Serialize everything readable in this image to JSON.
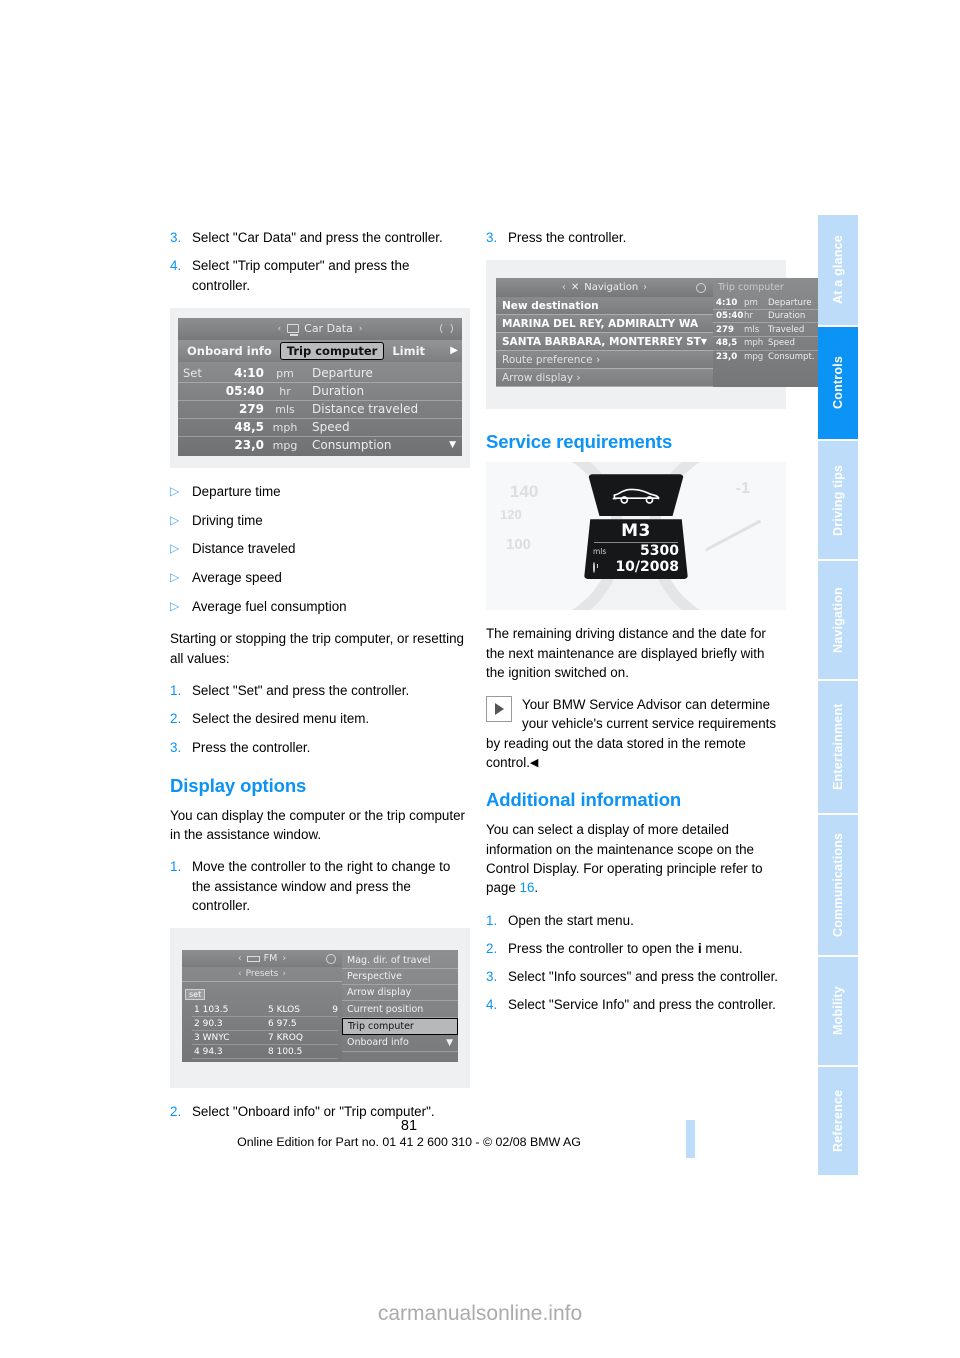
{
  "document": {
    "page_number": "81",
    "footer_line": "Online Edition for Part no. 01 41 2 600 310 - © 02/08 BMW AG",
    "watermark": "carmanualsonline.info"
  },
  "colors": {
    "accent": "#0b93f6",
    "tab_inactive": "#bcdcfa",
    "text": "#000000"
  },
  "sidebar": {
    "tabs": [
      {
        "label": "At a glance",
        "active": false
      },
      {
        "label": "Controls",
        "active": true
      },
      {
        "label": "Driving tips",
        "active": false
      },
      {
        "label": "Navigation",
        "active": false
      },
      {
        "label": "Entertainment",
        "active": false
      },
      {
        "label": "Communications",
        "active": false
      },
      {
        "label": "Mobility",
        "active": false
      },
      {
        "label": "Reference",
        "active": false
      }
    ]
  },
  "left_column": {
    "steps_top": [
      {
        "num": "3.",
        "text": "Select \"Car Data\" and press the controller."
      },
      {
        "num": "4.",
        "text": "Select \"Trip computer\" and press the controller."
      }
    ],
    "figure_car_data": {
      "title": "Car Data",
      "tabs": [
        {
          "label": "Onboard info",
          "selected": false
        },
        {
          "label": "Trip computer",
          "selected": true
        },
        {
          "label": "Limit",
          "selected": false
        }
      ],
      "set_label": "Set",
      "rows": [
        {
          "value": "4:10",
          "unit": "pm",
          "label": "Departure"
        },
        {
          "value": "05:40",
          "unit": "hr",
          "label": "Duration"
        },
        {
          "value": "279",
          "unit": "mls",
          "label": "Distance traveled"
        },
        {
          "value": "48,5",
          "unit": "mph",
          "label": "Speed"
        },
        {
          "value": "23,0",
          "unit": "mpg",
          "label": "Consumption"
        }
      ]
    },
    "bullets": [
      "Departure time",
      "Driving time",
      "Distance traveled",
      "Average speed",
      "Average fuel consumption"
    ],
    "intro_paragraph": "Starting or stopping the trip computer, or resetting all values:",
    "steps_mid": [
      {
        "num": "1.",
        "text": "Select \"Set\" and press the controller."
      },
      {
        "num": "2.",
        "text": "Select the desired menu item."
      },
      {
        "num": "3.",
        "text": "Press the controller."
      }
    ],
    "display_options": {
      "heading": "Display options",
      "paragraph": "You can display the computer or the trip computer in the assistance window.",
      "steps": [
        {
          "num": "1.",
          "text": "Move the controller to the right to change to the assistance window and press the controller."
        },
        {
          "num": "2.",
          "text": "Select \"Onboard info\" or \"Trip computer\"."
        }
      ]
    },
    "figure_radio": {
      "band": "FM",
      "presets_label": "Presets",
      "set_button": "set",
      "stations": [
        {
          "left": "1 103.5",
          "mid": "5 KLOS",
          "right": "9"
        },
        {
          "left": "2 90.3",
          "mid": "6 97.5",
          "right": ""
        },
        {
          "left": "3 WNYC",
          "mid": "7 KROQ",
          "right": ""
        },
        {
          "left": "4 94.3",
          "mid": "8 100.5",
          "right": ""
        }
      ],
      "menu": [
        {
          "label": "Mag. dir. of travel",
          "selected": false
        },
        {
          "label": "Perspective",
          "selected": false
        },
        {
          "label": "Arrow display",
          "selected": false
        },
        {
          "label": "Current position",
          "selected": false
        },
        {
          "label": "Trip computer",
          "selected": true
        },
        {
          "label": "Onboard info",
          "selected": false
        }
      ]
    }
  },
  "right_column": {
    "step_top": {
      "num": "3.",
      "text": "Press the controller."
    },
    "figure_navigation": {
      "title": "Navigation",
      "items": [
        {
          "label": "New destination",
          "dim": false
        },
        {
          "label": "MARINA DEL REY, ADMIRALTY WA",
          "dim": false
        },
        {
          "label": "SANTA BARBARA, MONTERREY ST",
          "dim": false
        },
        {
          "label": "Route preference ›",
          "dim": true
        },
        {
          "label": "Arrow display ›",
          "dim": true
        }
      ],
      "trip_computer_title": "Trip computer",
      "trip_rows": [
        {
          "value": "4:10",
          "unit": "pm",
          "label": "Departure"
        },
        {
          "value": "05:40",
          "unit": "hr",
          "label": "Duration"
        },
        {
          "value": "279",
          "unit": "mls",
          "label": "Traveled"
        },
        {
          "value": "48,5",
          "unit": "mph",
          "label": "Speed"
        },
        {
          "value": "23,0",
          "unit": "mpg",
          "label": "Consumpt."
        }
      ]
    },
    "service_requirements": {
      "heading": "Service requirements",
      "cluster": {
        "service_code": "M3",
        "distance_unit": "mls",
        "distance_value": "5300",
        "date_value": "10/2008",
        "ghost_140": "140",
        "ghost_120": "120",
        "ghost_100": "100",
        "ghost_right": "-1"
      },
      "paragraph": "The remaining driving distance and the date for the next maintenance are displayed briefly with the ignition switched on.",
      "note_text_1": "Your BMW Service Advisor can determine your vehicle's current service requirements by reading out the data stored in the remote control.",
      "note_endmark": "◀"
    },
    "additional_information": {
      "heading": "Additional information",
      "paragraph_part1": "You can select a display of more detailed information on the maintenance scope on the Control Display. For operating principle refer to page ",
      "page_ref": "16",
      "paragraph_part2": ".",
      "steps": [
        {
          "num": "1.",
          "text": "Open the start menu."
        },
        {
          "num": "2.",
          "text_before": "Press the controller to open the ",
          "icon": "i",
          "text_after": " menu."
        },
        {
          "num": "3.",
          "text": "Select \"Info sources\" and press the controller."
        },
        {
          "num": "4.",
          "text": "Select \"Service Info\" and press the controller."
        }
      ]
    }
  }
}
